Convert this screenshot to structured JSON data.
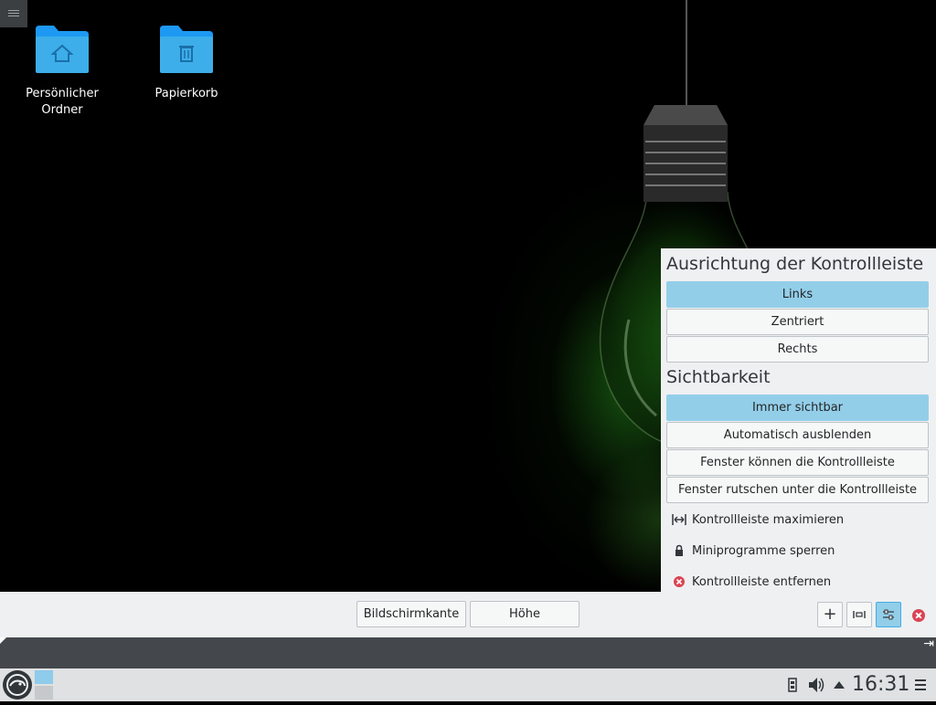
{
  "desktop": {
    "icons": [
      {
        "label": "Persönlicher Ordner",
        "icon": "home-folder-icon"
      },
      {
        "label": "Papierkorb",
        "icon": "trash-folder-icon"
      }
    ]
  },
  "panel_config": {
    "alignment": {
      "title": "Ausrichtung der Kontrollleiste",
      "options": [
        "Links",
        "Zentriert",
        "Rechts"
      ],
      "selected": "Links"
    },
    "visibility": {
      "title": "Sichtbarkeit",
      "options": [
        "Immer sichtbar",
        "Automatisch ausblenden",
        "Fenster können die Kontrollleiste überdecken",
        "Fenster rutschen unter die Kontrollleiste"
      ],
      "selected": "Immer sichtbar"
    },
    "actions": [
      {
        "label": "Kontrollleiste maximieren",
        "icon": "maximize-panel-icon"
      },
      {
        "label": "Miniprogramme sperren",
        "icon": "lock-icon"
      },
      {
        "label": "Kontrollleiste entfernen",
        "icon": "remove-icon"
      }
    ]
  },
  "config_bar": {
    "screen_edge_label": "Bildschirmkante",
    "height_label": "Höhe",
    "add_icon": "plus-icon",
    "spacer_icon": "spacer-icon",
    "settings_icon": "more-settings-icon",
    "close_icon": "close-icon"
  },
  "taskbar": {
    "clock": "16:31",
    "tray_icons": [
      "usb-device-icon",
      "volume-icon",
      "tray-expand-icon",
      "menu-icon"
    ]
  },
  "colors": {
    "accent": "#93cee9",
    "panel_bg": "#eff0f1",
    "remove": "#da4453"
  }
}
